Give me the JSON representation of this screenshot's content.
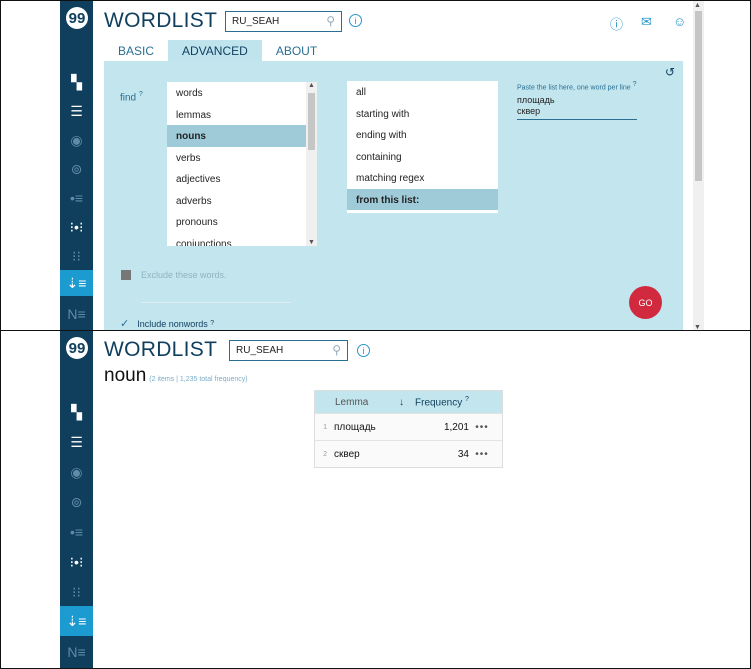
{
  "app": {
    "title": "WORDLIST",
    "logo_glyph": "99"
  },
  "corpus": {
    "value": "RU_SEAH"
  },
  "info_glyph": "i",
  "tabs": [
    {
      "label": "BASIC"
    },
    {
      "label": "ADVANCED"
    },
    {
      "label": "ABOUT"
    }
  ],
  "form": {
    "find_label": "find",
    "help_mark": "?",
    "attribute_list": [
      "words",
      "lemmas",
      "nouns",
      "verbs",
      "adjectives",
      "adverbs",
      "pronouns",
      "conjunctions"
    ],
    "attribute_selected": "nouns",
    "filter_list": [
      "all",
      "starting with",
      "ending with",
      "containing",
      "matching regex",
      "from this list:"
    ],
    "filter_selected": "from this list:",
    "paste_label": "Paste the list here, one word per line",
    "paste_value_lines": [
      "площадь",
      "сквер"
    ],
    "exclude_label": "Exclude these words.",
    "nonwords_label": "Include nonwords",
    "go_label": "GO"
  },
  "result": {
    "word": "noun",
    "meta": "(2 items | 1,235 total frequency)",
    "columns": {
      "lemma": "Lemma",
      "frequency": "Frequency"
    },
    "rows": [
      {
        "n": "1",
        "lemma": "площадь",
        "freq": "1,201",
        "dots": "•••"
      },
      {
        "n": "2",
        "lemma": "сквер",
        "freq": "34",
        "dots": "•••"
      }
    ]
  },
  "colors": {
    "rail": "#0f3f5d",
    "accent": "#1c9bd1",
    "panel": "#c2e5ee",
    "go": "#d12a3e"
  }
}
